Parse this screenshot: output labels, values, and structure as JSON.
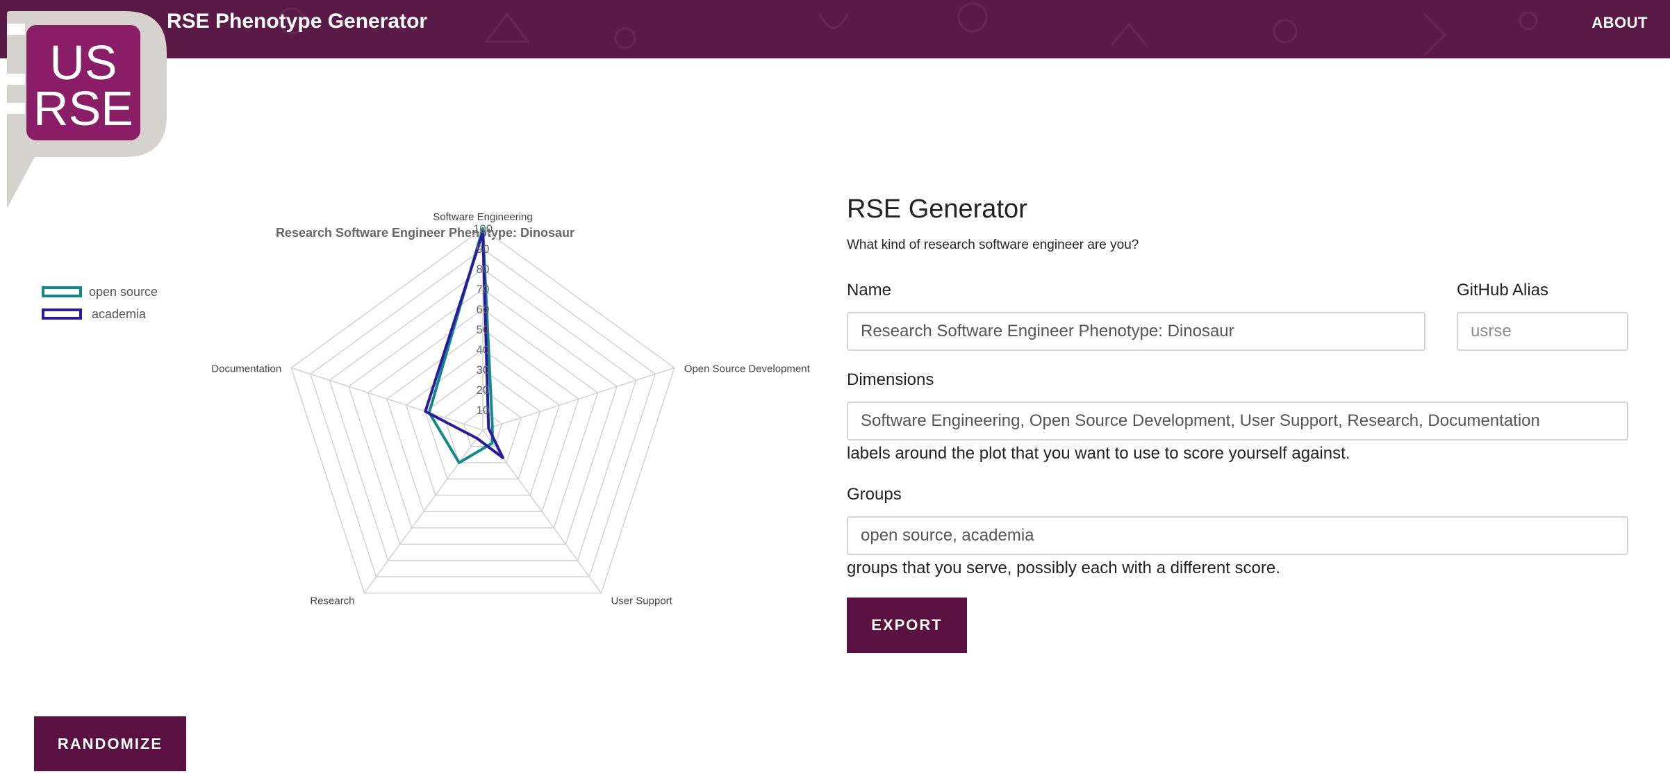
{
  "header": {
    "title": "RSE Phenotype Generator",
    "about_label": "ABOUT",
    "background_color": "#5a1a48"
  },
  "logo": {
    "line1": "US",
    "line2": "RSE",
    "color": "#8a1e66"
  },
  "chart_data": {
    "type": "radar",
    "title": "Research Software Engineer Phenotype: Dinosaur",
    "axes": [
      "Software Engineering",
      "Open Source Development",
      "User Support",
      "Research",
      "Documentation"
    ],
    "rlim": [
      0,
      100
    ],
    "ticks": [
      10,
      20,
      30,
      40,
      50,
      60,
      70,
      80,
      90,
      100
    ],
    "grid": true,
    "legend_position": "top-left",
    "series": [
      {
        "name": "open source",
        "color": "#138a8a",
        "values": [
          100,
          5,
          8,
          20,
          28
        ]
      },
      {
        "name": "academia",
        "color": "#2a1a9e",
        "values": [
          98,
          3,
          17,
          5,
          30
        ]
      }
    ]
  },
  "randomize_label": "RANDOMIZE",
  "form": {
    "title": "RSE Generator",
    "subtitle": "What kind of research software engineer are you?",
    "name_label": "Name",
    "name_value": "Research Software Engineer Phenotype: Dinosaur",
    "github_label": "GitHub Alias",
    "github_placeholder": "usrse",
    "dimensions_label": "Dimensions",
    "dimensions_value": "Software Engineering, Open Source Development, User Support, Research, Documentation",
    "dimensions_help": "labels around the plot that you want to use to score yourself against.",
    "groups_label": "Groups",
    "groups_value": "open source, academia",
    "groups_help": "groups that you serve, possibly each with a different score.",
    "export_label": "EXPORT",
    "button_color": "#5a1040"
  }
}
